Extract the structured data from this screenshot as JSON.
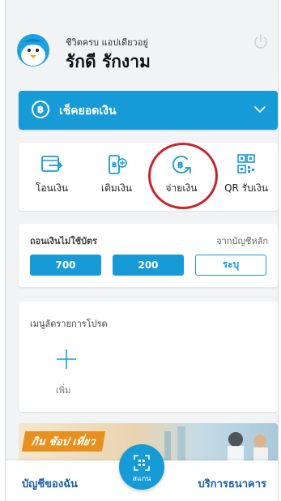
{
  "profile": {
    "greeting": "ชีวิตครบ แอปเดียวอยู่",
    "name": "รักดี รักงาม"
  },
  "balance": {
    "label": "เช็คยอดเงิน",
    "currency_symbol": "฿"
  },
  "actions": [
    {
      "label": "โอนเงิน",
      "icon": "transfer-icon"
    },
    {
      "label": "เติมเงิน",
      "icon": "topup-icon"
    },
    {
      "label": "จ่ายเงิน",
      "icon": "pay-icon"
    },
    {
      "label": "QR รับเงิน",
      "icon": "qr-icon"
    }
  ],
  "cardless": {
    "title": "ถอนเงินไม่ใช้บัตร",
    "source": "จากบัญชีหลัก",
    "amounts": [
      "700",
      "200",
      "ระบุ"
    ]
  },
  "favorites": {
    "title": "เมนูลัดรายการโปรด",
    "add_label": "เพิ่ม"
  },
  "promo": {
    "tag": "กิน ช้อป เที่ยว"
  },
  "bottom_nav": {
    "left": "บัญชีของฉัน",
    "center": "สแกน",
    "right": "บริการธนาคาร"
  },
  "colors": {
    "primary": "#169bd7",
    "highlight": "#c8262b",
    "nav_text": "#1a5fa8"
  }
}
